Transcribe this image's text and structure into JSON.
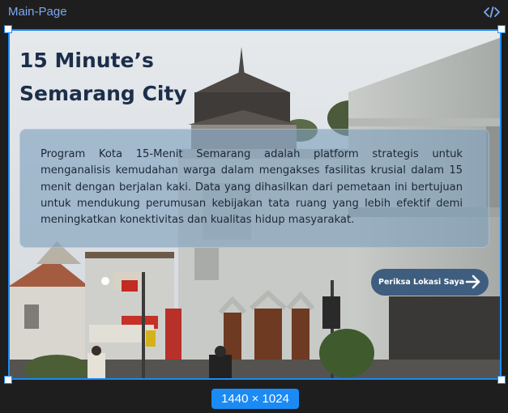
{
  "editor": {
    "frame_name": "Main-Page",
    "code_icon": "code-icon",
    "frame_size": "1440 × 1024",
    "selection_color": "#1b8af5"
  },
  "hero": {
    "title": "15 Minute’s Semarang City",
    "description": "Program Kota 15-Menit Semarang adalah platform strategis untuk menganalisis kemudahan warga dalam mengakses fasilitas krusial dalam 15 menit dengan berjalan kaki. Data yang dihasilkan dari pemetaan ini bertujuan untuk mendukung perumusan kebijakan tata ruang yang lebih efektif demi meningkatkan konektivitas dan kualitas hidup masyarakat.",
    "cta_label": "Periksa Lokasi Saya",
    "cta_icon": "arrow-right-icon",
    "background": "street-photo-semarang-old-buildings"
  },
  "colors": {
    "title": "#1c2e4a",
    "card": "#7ea0bd",
    "cta": "#3f5d7e"
  }
}
